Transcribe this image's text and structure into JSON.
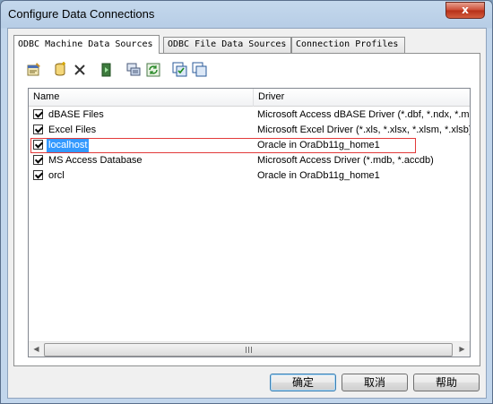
{
  "window": {
    "title": "Configure Data Connections",
    "close_glyph": "x"
  },
  "tabs": [
    {
      "label": "ODBC Machine Data Sources",
      "active": true
    },
    {
      "label": "ODBC File Data Sources",
      "active": false
    },
    {
      "label": "Connection Profiles",
      "active": false
    }
  ],
  "toolbar": {
    "icons": [
      "properties-icon",
      "new-datasource-icon",
      "delete-icon",
      "connect-icon",
      "configure-icon",
      "refresh-icon",
      "check-all-icon",
      "uncheck-all-icon"
    ]
  },
  "list": {
    "columns": [
      "Name",
      "Driver"
    ],
    "rows": [
      {
        "name": "dBASE Files",
        "driver": "Microsoft Access dBASE Driver (*.dbf, *.ndx, *.m...",
        "checked": true,
        "selected": false
      },
      {
        "name": "Excel Files",
        "driver": "Microsoft Excel Driver (*.xls, *.xlsx, *.xlsm, *.xlsb)",
        "checked": true,
        "selected": false
      },
      {
        "name": "localhost",
        "driver": "Oracle in OraDb11g_home1",
        "checked": true,
        "selected": true
      },
      {
        "name": "MS Access Database",
        "driver": "Microsoft Access Driver (*.mdb, *.accdb)",
        "checked": true,
        "selected": false
      },
      {
        "name": "orcl",
        "driver": "Oracle in OraDb11g_home1",
        "checked": true,
        "selected": false
      }
    ],
    "scroll_left_glyph": "◀",
    "scroll_right_glyph": "▶"
  },
  "buttons": {
    "ok": "确定",
    "cancel": "取消",
    "help": "帮助"
  }
}
